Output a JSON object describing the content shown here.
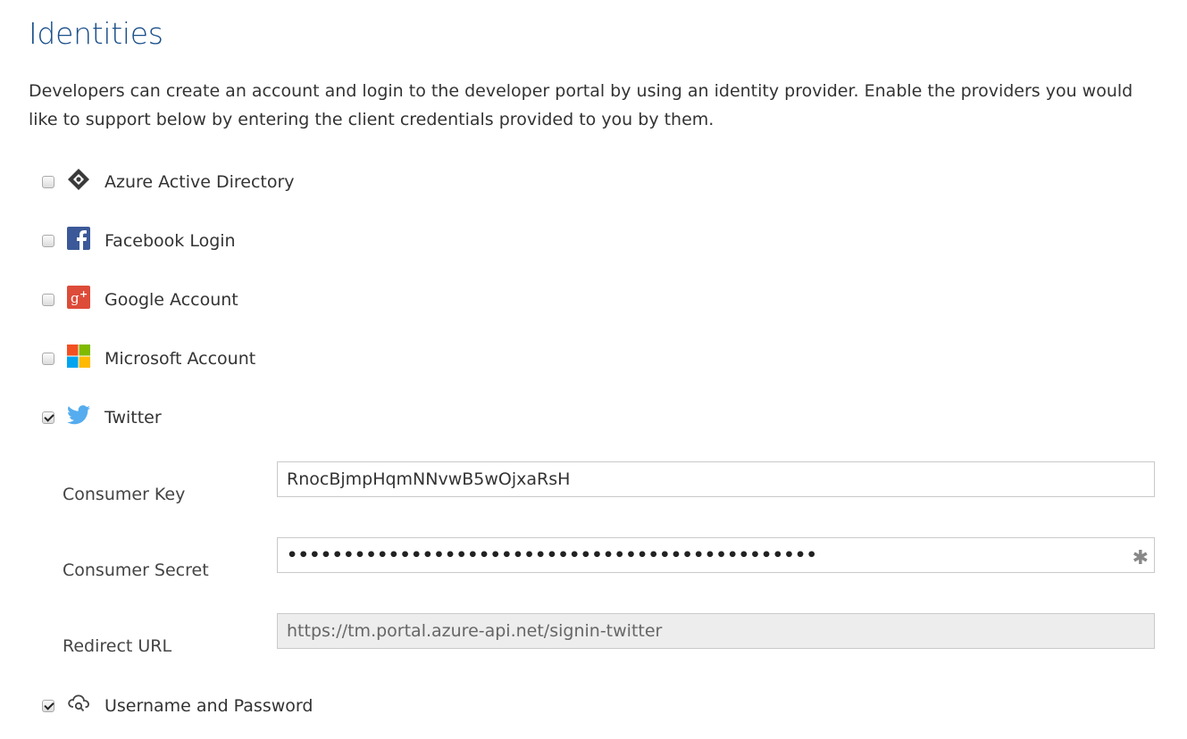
{
  "header": {
    "title": "Identities",
    "description": "Developers can create an account and login to the developer portal by using an identity provider. Enable the providers you would like to support below by entering the client credentials provided to you by them."
  },
  "providers": [
    {
      "label": "Azure Active Directory",
      "checked": false,
      "icon": "azure-ad-icon"
    },
    {
      "label": "Facebook Login",
      "checked": false,
      "icon": "facebook-icon"
    },
    {
      "label": "Google Account",
      "checked": false,
      "icon": "google-plus-icon"
    },
    {
      "label": "Microsoft Account",
      "checked": false,
      "icon": "microsoft-icon"
    },
    {
      "label": "Twitter",
      "checked": true,
      "icon": "twitter-icon"
    },
    {
      "label": "Username and Password",
      "checked": true,
      "icon": "username-password-icon"
    }
  ],
  "twitter": {
    "consumer_key_label": "Consumer Key",
    "consumer_key_value": "RnocBjmpHqmNNvwB5wOjxaRsH",
    "consumer_secret_label": "Consumer Secret",
    "consumer_secret_value": "•••••••••••••••••••••••••••••••••••••••••••••••",
    "redirect_url_label": "Redirect URL",
    "redirect_url_value": "https://tm.portal.azure-api.net/signin-twitter"
  },
  "colors": {
    "title": "#1a4f8a",
    "facebook": "#3b5998",
    "google": "#dd4b39",
    "twitter": "#55acee"
  }
}
